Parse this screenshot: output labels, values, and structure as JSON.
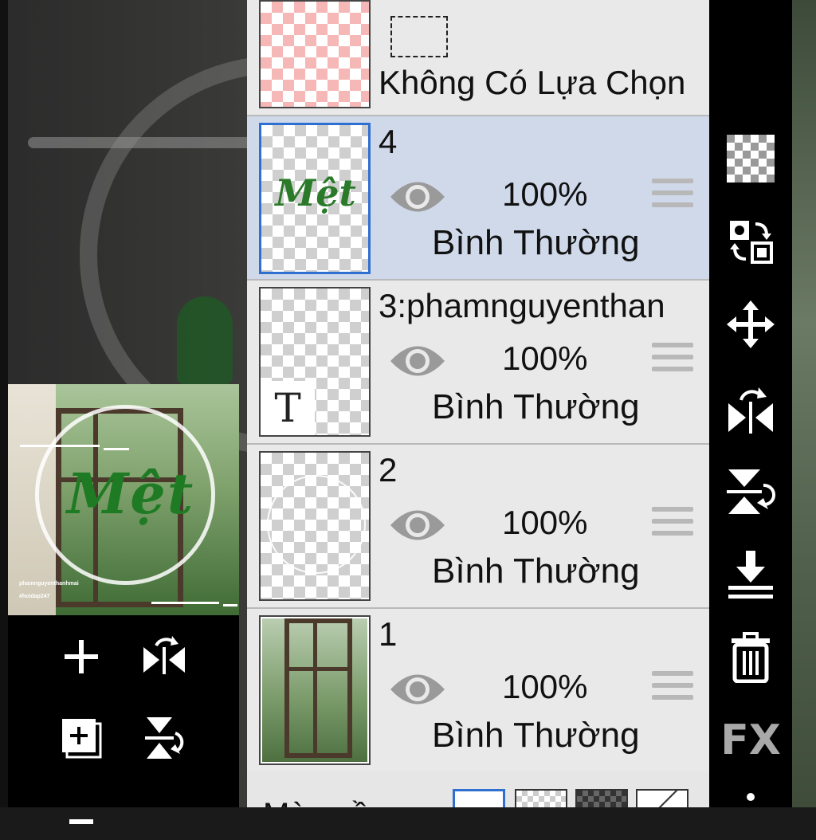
{
  "preview": {
    "word": "Mệt",
    "caption_name": "phamnguyenthanhmai",
    "caption_tag": "#hoidap247"
  },
  "layers": {
    "top": {
      "selection_label": "Không Có Lựa Chọn"
    },
    "items": [
      {
        "name": "4",
        "opacity": "100%",
        "blend": "Bình Thường",
        "selected": true,
        "thumb_text": "Mệt"
      },
      {
        "name": "3:phamnguyenthan",
        "opacity": "100%",
        "blend": "Bình Thường",
        "selected": false,
        "badge": "T"
      },
      {
        "name": "2",
        "opacity": "100%",
        "blend": "Bình Thường",
        "selected": false
      },
      {
        "name": "1",
        "opacity": "100%",
        "blend": "Bình Thường",
        "selected": false
      }
    ],
    "bottom_label": "Màu nền"
  },
  "right_toolbar": {
    "fx_label": "FX",
    "tools": [
      "checker-icon",
      "swap-color-icon",
      "move-icon",
      "flip-horizontal-icon",
      "flip-vertical-icon",
      "merge-down-icon",
      "trash-icon",
      "fx-icon",
      "more-icon"
    ]
  },
  "left_toolbar": {
    "tools": [
      "add-layer-icon",
      "flip-horizontal-icon",
      "add-copy-layer-icon",
      "flip-vertical-icon"
    ]
  },
  "colors": {
    "selected_bg": "#cfd9ea",
    "selected_border": "#2f6fd0",
    "green_text": "#2a7a2a",
    "panel_bg": "#e9e9e9"
  }
}
